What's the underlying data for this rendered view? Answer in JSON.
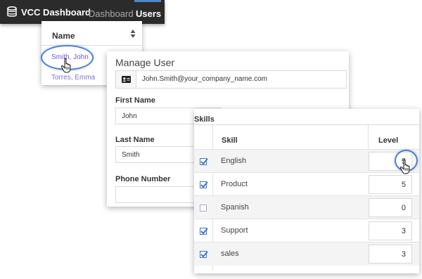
{
  "nav": {
    "brand": "VCC Dashboard",
    "links": [
      "Dashboard",
      "Users"
    ],
    "active": "Users",
    "accent_color": "#4f86c6",
    "brand_icon": "database-icon"
  },
  "users_list": {
    "header": "Name",
    "sort_icon": "sort-icon",
    "rows": [
      "Smith, John",
      "Torres, Emma"
    ],
    "highlight_color": "#4d7fd6"
  },
  "manage_user": {
    "title": "Manage User",
    "email_icon": "id-card-icon",
    "email": "John.Smith@your_company_name.com",
    "first_name_label": "First Name",
    "first_name": "John",
    "last_name_label": "Last Name",
    "last_name": "Smith",
    "phone_label": "Phone Number",
    "phone": ""
  },
  "skills": {
    "title": "Skills",
    "columns": {
      "skill": "Skill",
      "level": "Level"
    },
    "rows": [
      {
        "skill": "English",
        "level": "5",
        "checked": true
      },
      {
        "skill": "Product",
        "level": "5",
        "checked": true
      },
      {
        "skill": "Spanish",
        "level": "0",
        "checked": false
      },
      {
        "skill": "Support",
        "level": "3",
        "checked": true
      },
      {
        "skill": "sales",
        "level": "3",
        "checked": true
      }
    ],
    "check_color": "#3c77c9"
  }
}
